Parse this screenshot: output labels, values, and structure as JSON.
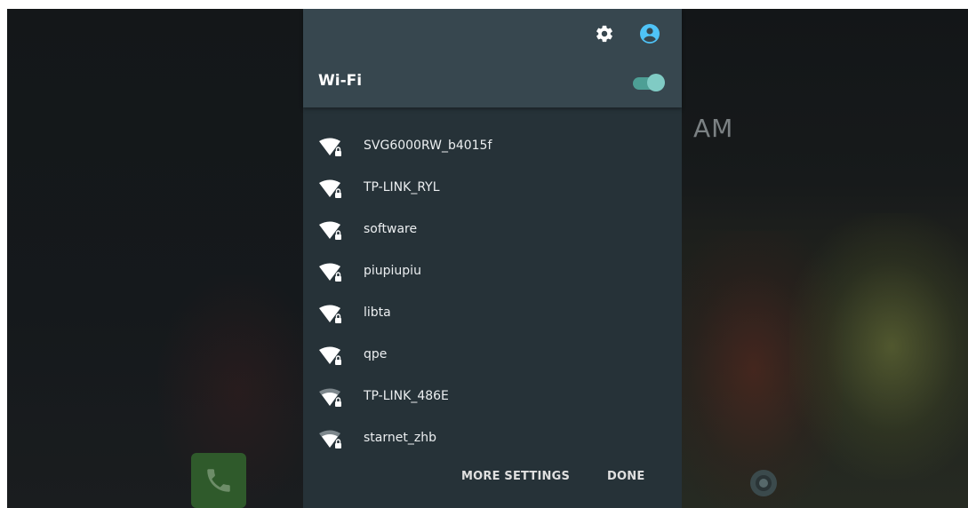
{
  "background": {
    "clock_text": "AM"
  },
  "panel": {
    "header": {
      "settings_icon": "gear-icon",
      "user_icon": "account-circle-icon",
      "title": "Wi-Fi",
      "toggle_on": true
    },
    "networks": [
      {
        "name": "SVG6000RW_b4015f",
        "signal_strength": "full",
        "secured": true
      },
      {
        "name": "TP-LINK_RYL",
        "signal_strength": "full",
        "secured": true
      },
      {
        "name": "software",
        "signal_strength": "full",
        "secured": true
      },
      {
        "name": "piupiupiu",
        "signal_strength": "full",
        "secured": true
      },
      {
        "name": "libta",
        "signal_strength": "full",
        "secured": true
      },
      {
        "name": "qpe",
        "signal_strength": "full",
        "secured": true
      },
      {
        "name": "TP-LINK_486E",
        "signal_strength": "partial",
        "secured": true
      },
      {
        "name": "starnet_zhb",
        "signal_strength": "partial",
        "secured": true
      }
    ],
    "footer": {
      "more_settings_label": "MORE SETTINGS",
      "done_label": "DONE"
    }
  },
  "colors": {
    "panel_bg": "#263238",
    "header_bg": "#37474f",
    "accent": "#4fc3f7",
    "toggle": "#80cbc4"
  }
}
